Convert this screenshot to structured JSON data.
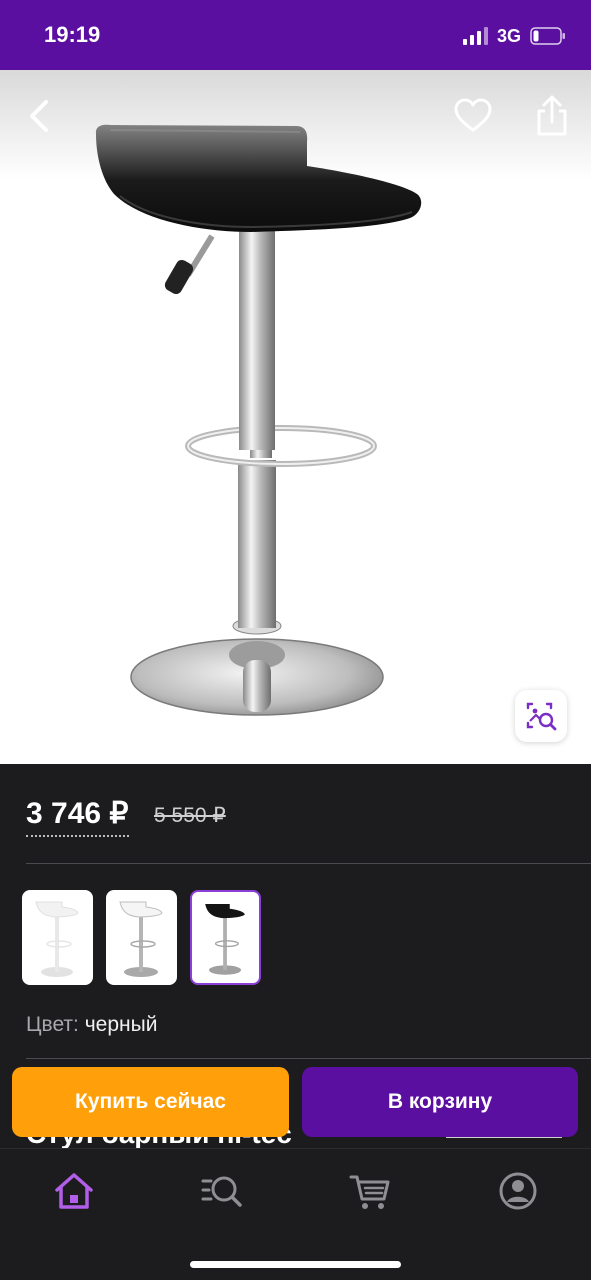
{
  "status_bar": {
    "time": "19:19",
    "network": "3G"
  },
  "product": {
    "price": "3 746 ₽",
    "old_price": "5 550 ₽",
    "color_label": "Цвет:",
    "color_value": "черный",
    "title": "Стул барный hi-tec",
    "variants": [
      {
        "color": "белый",
        "selected": false
      },
      {
        "color": "белый",
        "selected": false
      },
      {
        "color": "черный",
        "selected": true
      }
    ]
  },
  "actions": {
    "buy_now": "Купить сейчас",
    "add_to_cart": "В корзину"
  },
  "tab_bar": {
    "items": [
      "home-icon",
      "catalog-search-icon",
      "cart-icon",
      "profile-icon"
    ],
    "active": "home-icon"
  },
  "colors": {
    "brand_purple": "#5a0fa0",
    "accent_orange": "#ff9f0a",
    "active_tab": "#b15ee8"
  }
}
